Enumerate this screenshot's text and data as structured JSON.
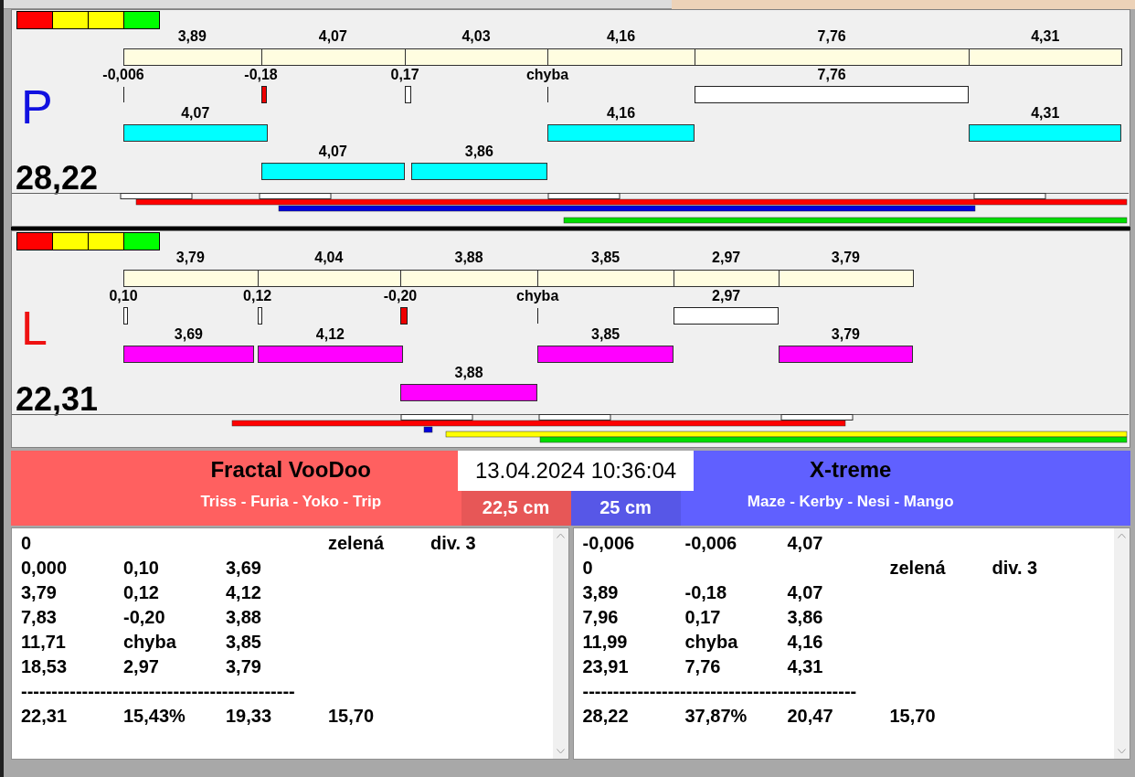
{
  "panels": [
    {
      "letter": "P",
      "total": "28,22",
      "color": "#00ffff",
      "segments": [
        "3,89",
        "4,07",
        "4,03",
        "4,16",
        "7,76",
        "4,31"
      ],
      "lanes": [
        [
          {
            "kind": "tick",
            "label": "-0,006"
          },
          {
            "kind": "fault",
            "label": "-0,18"
          },
          {
            "kind": "gap",
            "label": "0,17"
          },
          {
            "kind": "tick",
            "label": "chyba"
          },
          {
            "kind": "gap",
            "label": "7,76"
          },
          {
            "kind": "empty"
          }
        ],
        [
          {
            "kind": "bar",
            "label": "4,07"
          },
          {
            "kind": "empty"
          },
          {
            "kind": "empty"
          },
          {
            "kind": "bar",
            "label": "4,16"
          },
          {
            "kind": "empty"
          },
          {
            "kind": "bar",
            "label": "4,31"
          }
        ],
        [
          {
            "kind": "empty"
          },
          {
            "kind": "bar",
            "label": "4,07"
          },
          {
            "kind": "bar_end",
            "label": "3,86"
          },
          {
            "kind": "empty"
          },
          {
            "kind": "empty"
          },
          {
            "kind": "empty"
          }
        ]
      ]
    },
    {
      "letter": "L",
      "total": "22,31",
      "color": "#ff00ff",
      "segments": [
        "3,79",
        "4,04",
        "3,88",
        "3,85",
        "2,97",
        "3,79"
      ],
      "lanes": [
        [
          {
            "kind": "gap",
            "label": "0,10"
          },
          {
            "kind": "gap",
            "label": "0,12"
          },
          {
            "kind": "fault",
            "label": "-0,20"
          },
          {
            "kind": "tick",
            "label": "chyba"
          },
          {
            "kind": "gap",
            "label": "2,97"
          },
          {
            "kind": "empty"
          }
        ],
        [
          {
            "kind": "bar",
            "label": "3,69"
          },
          {
            "kind": "bar",
            "label": "4,12"
          },
          {
            "kind": "empty"
          },
          {
            "kind": "bar",
            "label": "3,85"
          },
          {
            "kind": "empty"
          },
          {
            "kind": "bar",
            "label": "3,79"
          }
        ],
        [
          {
            "kind": "empty"
          },
          {
            "kind": "empty"
          },
          {
            "kind": "bar",
            "label": "3,88"
          },
          {
            "kind": "empty"
          },
          {
            "kind": "empty"
          },
          {
            "kind": "empty"
          }
        ]
      ]
    }
  ],
  "timestamp": "13.04.2024 10:36:04",
  "teams": [
    {
      "name": "Fractal VooDoo",
      "dogs": "Triss - Furia - Yoko - Trip",
      "height": "22,5 cm",
      "color": "#ff6060",
      "rows": [
        {
          "kind": "line",
          "column_1": "0",
          "column_4": "zelená",
          "column_5": "div. 3"
        },
        {
          "kind": "line",
          "column_1": "0,000",
          "column_2": "0,10",
          "column_3": "3,69"
        },
        {
          "kind": "line",
          "column_1": "3,79",
          "column_2": "0,12",
          "column_3": "4,12"
        },
        {
          "kind": "line",
          "column_1": "7,83",
          "column_2": "-0,20",
          "column_3": "3,88"
        },
        {
          "kind": "line",
          "column_1": "11,71",
          "column_2": "chyba",
          "column_3": "3,85"
        },
        {
          "kind": "line",
          "column_1": "18,53",
          "column_2": "2,97",
          "column_3": "3,79"
        },
        {
          "kind": "separator",
          "text": "---------------------------------------------"
        },
        {
          "kind": "line",
          "column_1": "22,31",
          "column_2": "15,43%",
          "column_3": "19,33",
          "column_4": "15,70"
        }
      ]
    },
    {
      "name": "X-treme",
      "dogs": "Maze - Kerby - Nesi - Mango",
      "height": "25 cm",
      "color": "#6060ff",
      "rows": [
        {
          "kind": "line",
          "column_1": "-0,006",
          "column_2": "-0,006",
          "column_3": "4,07"
        },
        {
          "kind": "line",
          "column_1": "0",
          "column_4": "zelená",
          "column_5": "div. 3"
        },
        {
          "kind": "line",
          "column_1": "3,89",
          "column_2": "-0,18",
          "column_3": "4,07"
        },
        {
          "kind": "line",
          "column_1": "7,96",
          "column_2": "0,17",
          "column_3": "3,86"
        },
        {
          "kind": "line",
          "column_1": "11,99",
          "column_2": "chyba",
          "column_3": "4,16"
        },
        {
          "kind": "line",
          "column_1": "23,91",
          "column_2": "7,76",
          "column_3": "4,31"
        },
        {
          "kind": "separator",
          "text": "---------------------------------------------"
        },
        {
          "kind": "line",
          "column_1": "28,22",
          "column_2": "37,87%",
          "column_3": "20,47",
          "column_4": "15,70"
        }
      ]
    }
  ]
}
